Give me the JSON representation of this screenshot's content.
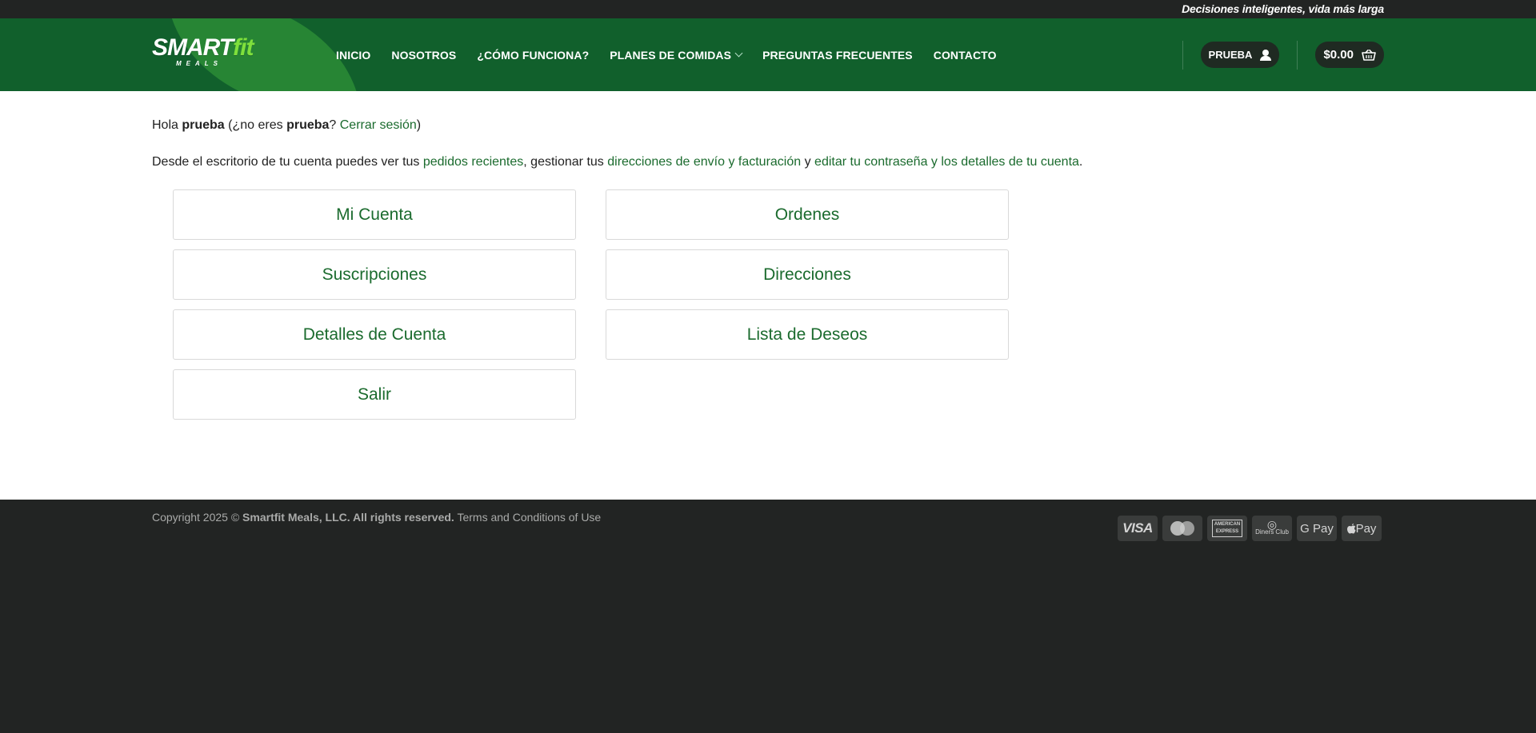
{
  "topbar": {
    "tagline": "Decisiones inteligentes, vida más larga"
  },
  "brand": {
    "logo_word": "SMART",
    "logo_fit": "fit",
    "logo_sub": "MEALS",
    "colors": {
      "header": "#11602c",
      "accent": "#7fe03c",
      "link": "#1b6b2e",
      "dark": "#222423"
    }
  },
  "nav": {
    "items": [
      {
        "label": "INICIO"
      },
      {
        "label": "NOSOTROS"
      },
      {
        "label": "¿CÓMO FUNCIONA?"
      },
      {
        "label": "PLANES DE COMIDAS"
      },
      {
        "label": "PREGUNTAS FRECUENTES"
      },
      {
        "label": "CONTACTO"
      }
    ]
  },
  "account": {
    "user_label": "PRUEBA",
    "user_icon": "user-icon",
    "cart_total": "$0.00",
    "cart_icon": "basket-icon"
  },
  "greeting": {
    "hello": "Hola ",
    "username": "prueba",
    "paren_open": " (¿no eres ",
    "username2": "prueba",
    "question": "? ",
    "logout": "Cerrar sesión",
    "paren_close": ")"
  },
  "intro": {
    "text1": "Desde el escritorio de tu cuenta puedes ver tus ",
    "link1": "pedidos recientes",
    "text2": ", gestionar tus ",
    "link2": "direcciones de envío y facturación",
    "text3": " y ",
    "link3": "editar tu contraseña y los detalles de tu cuenta",
    "text4": "."
  },
  "tiles": {
    "mi_cuenta": "Mi Cuenta",
    "ordenes": "Ordenes",
    "suscripciones": "Suscripciones",
    "direcciones": "Direcciones",
    "detalles": "Detalles de Cuenta",
    "deseos": "Lista de Deseos",
    "salir": "Salir"
  },
  "footer": {
    "copy_prefix": "Copyright 2025 © ",
    "company": "Smartfit Meals, LLC. All rights reserved.",
    "terms": "Terms and Conditions of Use",
    "payments": {
      "visa": "VISA",
      "amex": "AMERICAN EXPRESS",
      "diners": "Diners Club",
      "gpay": "G Pay",
      "apay": " Pay"
    }
  }
}
